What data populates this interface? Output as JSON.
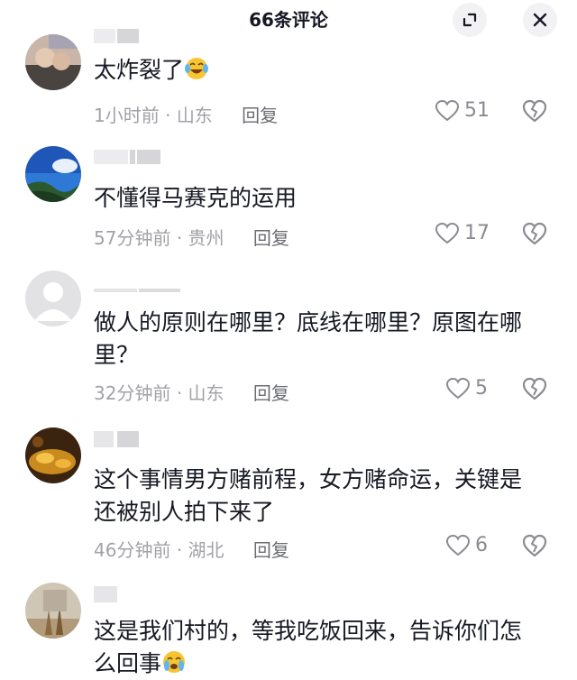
{
  "header": {
    "title": "66条评论",
    "expand_icon": "expand-icon",
    "close_icon": "close-icon"
  },
  "comments": [
    {
      "text": "太炸裂了",
      "emoji": "laughing-tears-emoji",
      "time": "1小时前",
      "location": "山东",
      "reply": "回复",
      "likes": "51"
    },
    {
      "text": "不懂得马赛克的运用",
      "time": "57分钟前",
      "location": "贵州",
      "reply": "回复",
      "likes": "17"
    },
    {
      "text": "做人的原则在哪里？底线在哪里？原图在哪里？",
      "time": "32分钟前",
      "location": "山东",
      "reply": "回复",
      "likes": "5"
    },
    {
      "text": "这个事情男方赌前程，女方赌命运，关键是还被别人拍下来了",
      "time": "46分钟前",
      "location": "湖北",
      "reply": "回复",
      "likes": "6"
    },
    {
      "text": "这是我们村的，等我吃饭回来，告诉你们怎么回事",
      "emoji": "crying-emoji"
    }
  ],
  "separator": "·",
  "colors": {
    "text": "#161823",
    "meta": "#a1a2a7",
    "reply": "#6b6c72",
    "icon": "#8a8b91"
  }
}
